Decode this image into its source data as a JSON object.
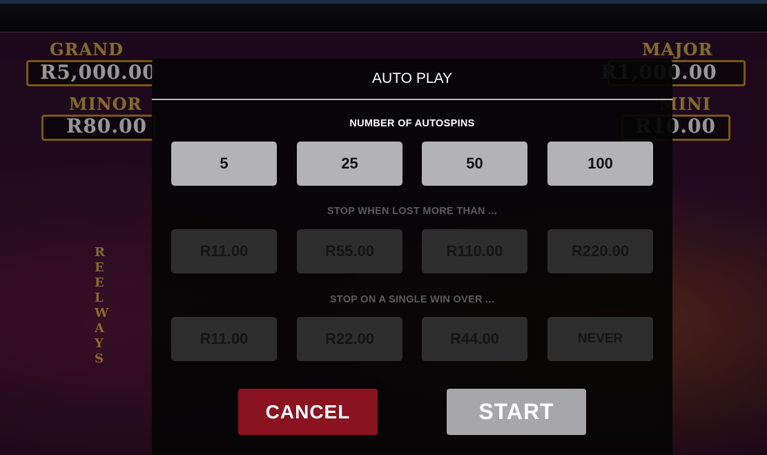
{
  "jackpots": {
    "grand": {
      "title": "GRAND",
      "value": "R5,000.00"
    },
    "major": {
      "title": "MAJOR",
      "value": "R1,000.00"
    },
    "minor": {
      "title": "MINOR",
      "value": "R80.00"
    },
    "mini": {
      "title": "MINI",
      "value": "R10.00"
    }
  },
  "reel_ways_label": "REEL WAYS",
  "dialog": {
    "title": "AUTO PLAY",
    "autospins": {
      "label": "NUMBER OF AUTOSPINS",
      "options": [
        "5",
        "25",
        "50",
        "100"
      ]
    },
    "loss_limit": {
      "label": "STOP WHEN LOST MORE THAN ...",
      "options": [
        "R11.00",
        "R55.00",
        "R110.00",
        "R220.00"
      ]
    },
    "single_win_limit": {
      "label": "STOP ON A SINGLE WIN OVER ...",
      "options": [
        "R11.00",
        "R22.00",
        "R44.00",
        "NEVER"
      ]
    },
    "cancel_label": "CANCEL",
    "start_label": "START"
  },
  "colors": {
    "cancel": "#8a1320",
    "start": "#a7a7aa",
    "option_active": "#b3b3b6",
    "option_inactive": "#2d2d2d"
  }
}
